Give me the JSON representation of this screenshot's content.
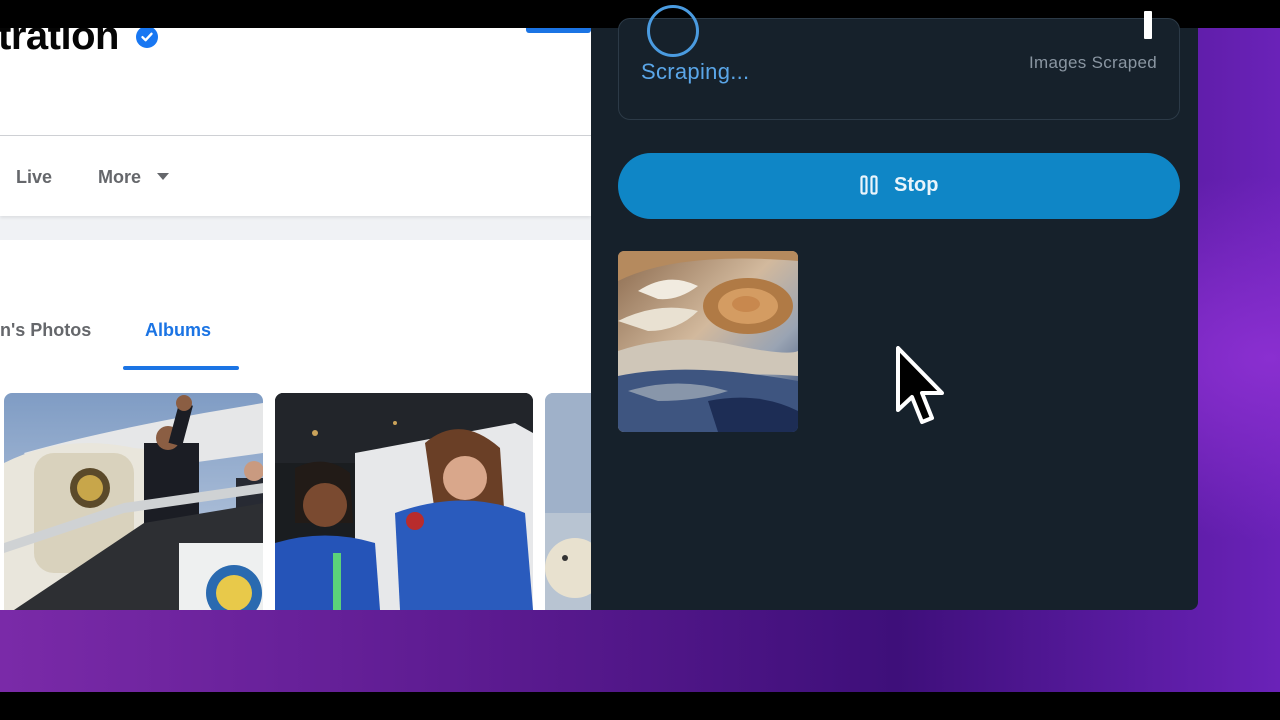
{
  "facebook": {
    "page_title": "tration",
    "nav": {
      "live": "Live",
      "more": "More"
    },
    "tabs": {
      "photos": "n's Photos",
      "albums": "Albums"
    }
  },
  "extension": {
    "status": "Scraping...",
    "images_scraped_value": "1",
    "images_scraped_label": "Images Scraped",
    "stop_label": "Stop"
  },
  "colors": {
    "fb_blue": "#1b74e4",
    "panel_bg": "#16212b",
    "stop_button": "#0f86c6",
    "status_text": "#5aa6e8"
  },
  "icons": [
    "verified-badge-icon",
    "caret-down-icon",
    "spinner-icon",
    "pause-icon",
    "mouse-cursor-icon"
  ]
}
